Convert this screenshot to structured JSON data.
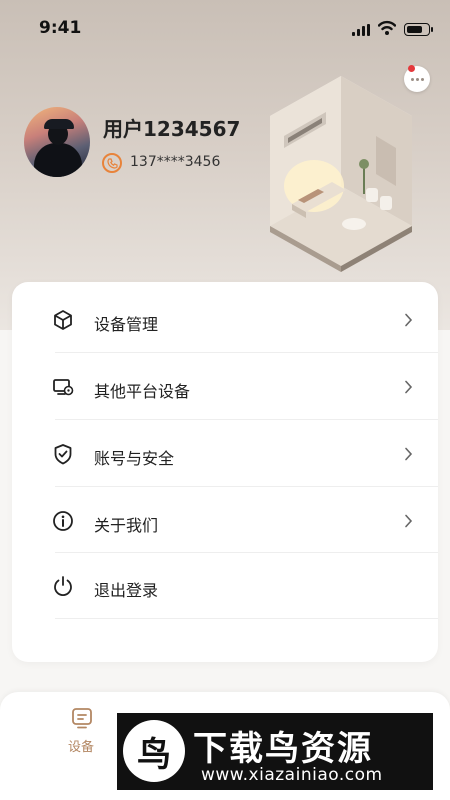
{
  "status_bar": {
    "time": "9:41",
    "battery_level": 0.8
  },
  "profile": {
    "username": "用户1234567",
    "phone": "137****3456"
  },
  "menu": {
    "items": [
      {
        "label": "设备管理",
        "icon": "cube-icon",
        "has_arrow": true
      },
      {
        "label": "其他平台设备",
        "icon": "monitor-settings-icon",
        "has_arrow": true
      },
      {
        "label": "账号与安全",
        "icon": "shield-check-icon",
        "has_arrow": true
      },
      {
        "label": "关于我们",
        "icon": "info-icon",
        "has_arrow": true
      },
      {
        "label": "退出登录",
        "icon": "power-icon",
        "has_arrow": false
      }
    ]
  },
  "tabbar": {
    "tabs": [
      {
        "label": "设备",
        "icon": "device-icon",
        "active": true
      }
    ]
  },
  "watermark": {
    "logo_char": "鸟",
    "title": "下载鸟资源",
    "url": "www.xiazainiao.com"
  },
  "colors": {
    "accent": "#b38763",
    "phone_icon": "#e8833a",
    "badge": "#e4393c"
  }
}
